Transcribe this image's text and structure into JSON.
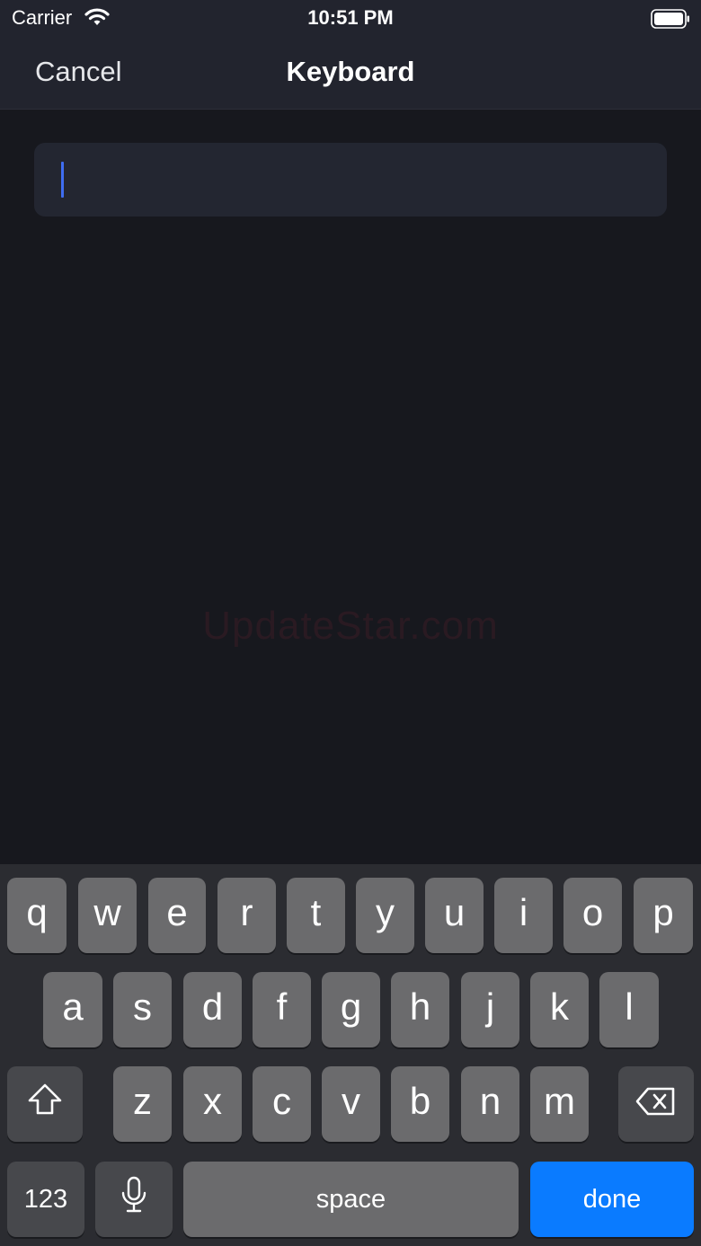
{
  "status_bar": {
    "carrier": "Carrier",
    "time": "10:51 PM"
  },
  "nav": {
    "cancel_label": "Cancel",
    "title": "Keyboard"
  },
  "text_field": {
    "value": ""
  },
  "watermark": "UpdateStar.com",
  "keyboard": {
    "row1": [
      "q",
      "w",
      "e",
      "r",
      "t",
      "y",
      "u",
      "i",
      "o",
      "p"
    ],
    "row2": [
      "a",
      "s",
      "d",
      "f",
      "g",
      "h",
      "j",
      "k",
      "l"
    ],
    "row3": [
      "z",
      "x",
      "c",
      "v",
      "b",
      "n",
      "m"
    ],
    "numbers_label": "123",
    "space_label": "space",
    "done_label": "done"
  },
  "colors": {
    "accent": "#0a7bff",
    "caret": "#3f6df1"
  }
}
